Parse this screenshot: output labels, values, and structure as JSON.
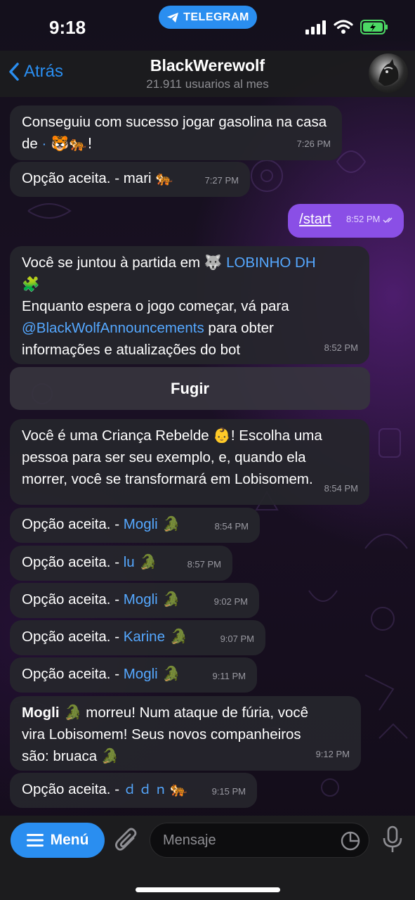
{
  "status_bar": {
    "time": "9:18",
    "app_pill": "TELEGRAM"
  },
  "header": {
    "back_label": "Atrás",
    "title": "BlackWerewolf",
    "subtitle": "21.911 usuarios al mes"
  },
  "messages": {
    "m1": {
      "text_a": "Conseguiu com sucesso jogar gasolina na casa de ",
      "dot": "·",
      "emoji": " 🐯🐅!",
      "time": "7:26 PM"
    },
    "m2": {
      "text": "Opção aceita. - mari ",
      "emoji": "🐅",
      "time": "7:27 PM"
    },
    "m3": {
      "command": "/start",
      "time": "8:52 PM"
    },
    "m4": {
      "line1": "Você se juntou à partida em ",
      "emoji1": "🐺",
      "group": " LOBINHO DH",
      "emoji2": "🧩",
      "line2": "Enquanto espera o jogo começar, vá para",
      "handle": "@BlackWolfAnnouncements",
      "line3": " para obter",
      "line4": "informações e atualizações do bot",
      "time": "8:52 PM"
    },
    "button_flee": "Fugir",
    "m5": {
      "line1": "Você é uma Criança Rebelde ",
      "emoji": "👶",
      "line1b": "! Escolha uma",
      "line2": "pessoa para ser seu exemplo, e, quando ela",
      "line3": "morrer, você se transformará em Lobisomem.",
      "time": "8:54 PM"
    },
    "m6": {
      "prefix": "Opção aceita. - ",
      "name": "Mogli",
      "emoji": " 🐊",
      "time": "8:54 PM"
    },
    "m7": {
      "prefix": "Opção aceita. - ",
      "name": "lu",
      "emoji": " 🐊",
      "time": "8:57 PM"
    },
    "m8": {
      "prefix": "Opção aceita. - ",
      "name": "Mogli",
      "emoji": " 🐊",
      "time": "9:02 PM"
    },
    "m9": {
      "prefix": "Opção aceita. - ",
      "name": "Karine",
      "emoji": " 🐊",
      "time": "9:07 PM"
    },
    "m10": {
      "prefix": "Opção aceita. - ",
      "name": "Mogli",
      "emoji": " 🐊",
      "time": "9:11 PM"
    },
    "m11": {
      "name": "Mogli",
      "emoji": " 🐊",
      "line1": " morreu! Num ataque de fúria, você",
      "line2": "vira Lobisomem! Seus novos companheiros",
      "line3": "são: bruaca ",
      "emoji2": "🐊",
      "time": "9:12 PM"
    },
    "m12": {
      "prefix": "Opção aceita. - ",
      "name": "ｄｄｎ",
      "emoji": "🐅",
      "time": "9:15 PM"
    }
  },
  "input_bar": {
    "menu_label": "Menú",
    "placeholder": "Mensaje"
  },
  "colors": {
    "accent": "#2a8ef0",
    "outgoing_bubble": "#8a4fe6",
    "incoming_bubble": "#26262c",
    "link": "#55a8ff"
  },
  "icons": [
    "chevron-left-icon",
    "paper-plane-icon",
    "signal-icon",
    "wifi-icon",
    "battery-icon",
    "menu-icon",
    "paperclip-icon",
    "sticker-icon",
    "microphone-icon",
    "double-check-icon"
  ]
}
